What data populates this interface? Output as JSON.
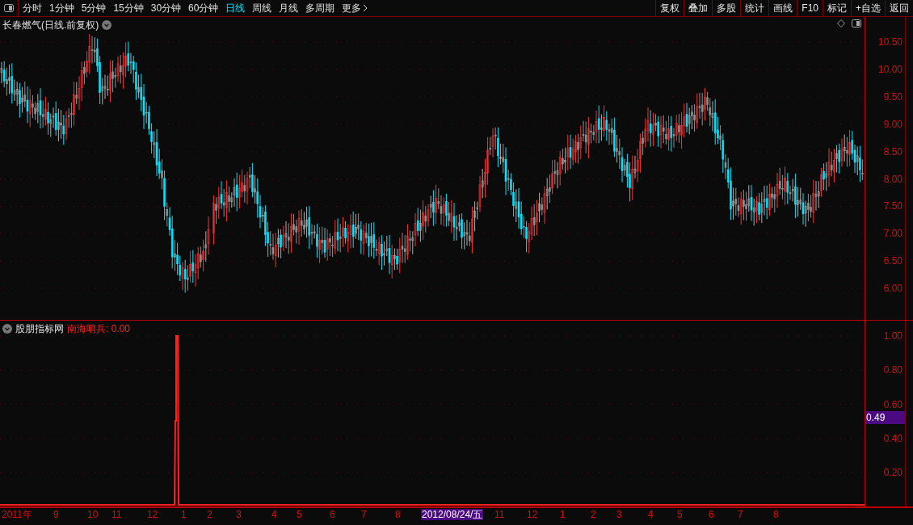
{
  "toolbar": {
    "periods": [
      {
        "label": "分时",
        "selected": false
      },
      {
        "label": "1分钟",
        "selected": false
      },
      {
        "label": "5分钟",
        "selected": false
      },
      {
        "label": "15分钟",
        "selected": false
      },
      {
        "label": "30分钟",
        "selected": false
      },
      {
        "label": "60分钟",
        "selected": false
      },
      {
        "label": "日线",
        "selected": true
      },
      {
        "label": "周线",
        "selected": false
      },
      {
        "label": "月线",
        "selected": false
      },
      {
        "label": "多周期",
        "selected": false
      },
      {
        "label": "更多",
        "selected": false
      }
    ],
    "buttons": [
      "复权",
      "叠加",
      "多股",
      "统计",
      "画线",
      "F10",
      "标记",
      "+自选",
      "返回"
    ]
  },
  "main_chart": {
    "title": "长春燃气(日线.前复权)",
    "price_axis": [
      "10.50",
      "10.00",
      "9.50",
      "9.00",
      "8.50",
      "8.00",
      "7.50",
      "7.00",
      "6.50",
      "6.00"
    ]
  },
  "indicator": {
    "source": "股朋指标网",
    "name": "南海哨兵: 0.00",
    "axis": [
      "1.00",
      "0.80",
      "0.60",
      "0.40",
      "0.20"
    ],
    "current_value": "0.49"
  },
  "date_axis": {
    "labels": [
      "2011年",
      "9",
      "10",
      "11",
      "12",
      "1",
      "2",
      "3",
      "4",
      "5",
      "6",
      "7",
      "8",
      "11",
      "12",
      "1",
      "2",
      "3",
      "4",
      "5",
      "6",
      "7",
      "8"
    ],
    "cursor_date": "2012/08/24/五"
  }
}
